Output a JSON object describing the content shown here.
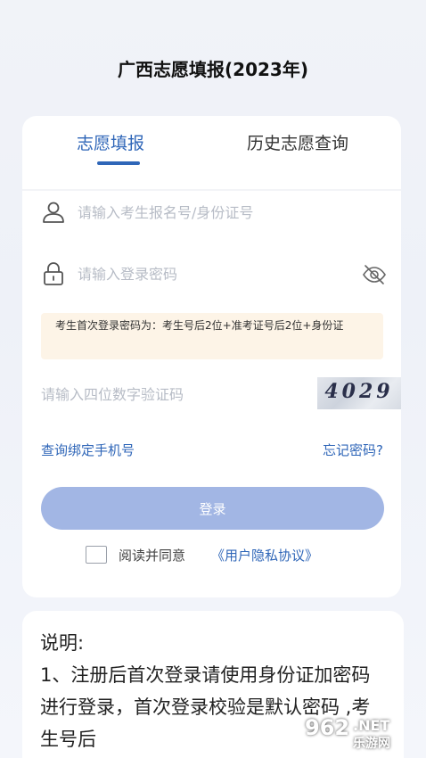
{
  "header": {
    "title": "广西志愿填报(2023年)"
  },
  "tabs": [
    {
      "label": "志愿填报",
      "active": true
    },
    {
      "label": "历史志愿查询",
      "active": false
    }
  ],
  "form": {
    "username_placeholder": "请输入考生报名号/身份证号",
    "username_value": "",
    "password_placeholder": "请输入登录密码",
    "password_value": "",
    "notice": "考生首次登录密码为：考生号后2位+准考证号后2位+身份证",
    "captcha_placeholder": "请输入四位数字验证码",
    "captcha_value": "",
    "captcha_image_text": "4029",
    "link_bind_phone": "查询绑定手机号",
    "link_forgot_password": "忘记密码?",
    "login_label": "登录",
    "agree_text": "阅读并同意",
    "agree_link": "《用户隐私协议》",
    "agree_checked": false
  },
  "notes": {
    "title": "说明:",
    "body": "1、注册后首次登录请使用身份证加密码进行登录，首次登录校验是默认密码 ,考生号后"
  },
  "watermark": {
    "logo": "962",
    "net": ".NET",
    "sub": "乐游网"
  },
  "colors": {
    "accent": "#2f66b8",
    "button": "#a2b6e4",
    "notice_bg": "#fdf4e7"
  },
  "icons": {
    "user": "user-icon",
    "lock": "lock-icon",
    "eye_off": "eye-off-icon"
  }
}
